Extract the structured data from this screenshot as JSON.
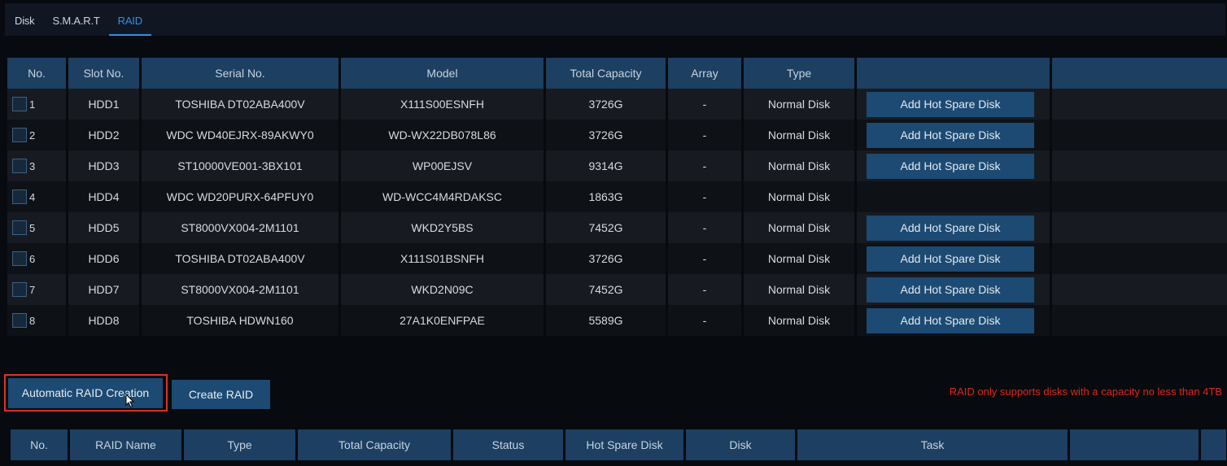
{
  "tabs": [
    {
      "label": "Disk"
    },
    {
      "label": "S.M.A.R.T"
    },
    {
      "label": "RAID"
    }
  ],
  "disk_table": {
    "headers": [
      "No.",
      "Slot No.",
      "Serial No.",
      "Model",
      "Total Capacity",
      "Array",
      "Type",
      "",
      ""
    ],
    "rows": [
      {
        "no": "1",
        "slot": "HDD1",
        "serial": "TOSHIBA DT02ABA400V",
        "model": "X111S00ESNFH",
        "capacity": "3726G",
        "array": "-",
        "type": "Normal Disk",
        "action": "Add Hot Spare Disk"
      },
      {
        "no": "2",
        "slot": "HDD2",
        "serial": "WDC WD40EJRX-89AKWY0",
        "model": "WD-WX22DB078L86",
        "capacity": "3726G",
        "array": "-",
        "type": "Normal Disk",
        "action": "Add Hot Spare Disk"
      },
      {
        "no": "3",
        "slot": "HDD3",
        "serial": "ST10000VE001-3BX101",
        "model": "WP00EJSV",
        "capacity": "9314G",
        "array": "-",
        "type": "Normal Disk",
        "action": "Add Hot Spare Disk"
      },
      {
        "no": "4",
        "slot": "HDD4",
        "serial": "WDC WD20PURX-64PFUY0",
        "model": "WD-WCC4M4RDAKSC",
        "capacity": "1863G",
        "array": "-",
        "type": "Normal Disk",
        "action": ""
      },
      {
        "no": "5",
        "slot": "HDD5",
        "serial": "ST8000VX004-2M1101",
        "model": "WKD2Y5BS",
        "capacity": "7452G",
        "array": "-",
        "type": "Normal Disk",
        "action": "Add Hot Spare Disk"
      },
      {
        "no": "6",
        "slot": "HDD6",
        "serial": "TOSHIBA DT02ABA400V",
        "model": "X111S01BSNFH",
        "capacity": "3726G",
        "array": "-",
        "type": "Normal Disk",
        "action": "Add Hot Spare Disk"
      },
      {
        "no": "7",
        "slot": "HDD7",
        "serial": "ST8000VX004-2M1101",
        "model": "WKD2N09C",
        "capacity": "7452G",
        "array": "-",
        "type": "Normal Disk",
        "action": "Add Hot Spare Disk"
      },
      {
        "no": "8",
        "slot": "HDD8",
        "serial": "TOSHIBA HDWN160",
        "model": "27A1K0ENFPAE",
        "capacity": "5589G",
        "array": "-",
        "type": "Normal Disk",
        "action": "Add Hot Spare Disk"
      }
    ]
  },
  "buttons": {
    "auto_raid": "Automatic RAID Creation",
    "create_raid": "Create RAID"
  },
  "warning": "RAID only supports disks with a capacity no less than 4TB",
  "raid_table": {
    "headers": [
      "No.",
      "RAID Name",
      "Type",
      "Total Capacity",
      "Status",
      "Hot Spare Disk",
      "Disk",
      "Task",
      "",
      ""
    ]
  },
  "colors": {
    "accent": "#2f90e6",
    "header_bg": "#1c3f62",
    "button_bg": "#1c4a72",
    "warning": "#e3231c",
    "highlight_outline": "#e03028"
  }
}
